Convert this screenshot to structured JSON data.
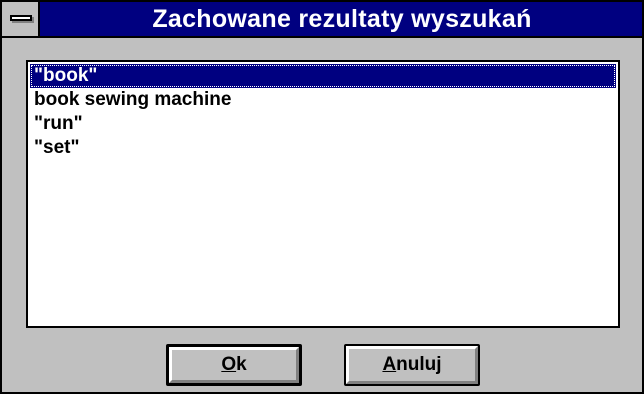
{
  "window": {
    "title": "Zachowane rezultaty wyszukań"
  },
  "list": {
    "items": [
      {
        "label": "\"book\"",
        "selected": true
      },
      {
        "label": "book sewing machine",
        "selected": false
      },
      {
        "label": "\"run\"",
        "selected": false
      },
      {
        "label": "\"set\"",
        "selected": false
      }
    ]
  },
  "buttons": {
    "ok": {
      "accel": "O",
      "rest": "k"
    },
    "cancel": {
      "accel": "A",
      "rest": "nuluj"
    }
  },
  "icons": {
    "system_menu": "system-menu-icon"
  },
  "colors": {
    "titlebar": "#000080",
    "face": "#c0c0c0",
    "selection": "#000080"
  }
}
